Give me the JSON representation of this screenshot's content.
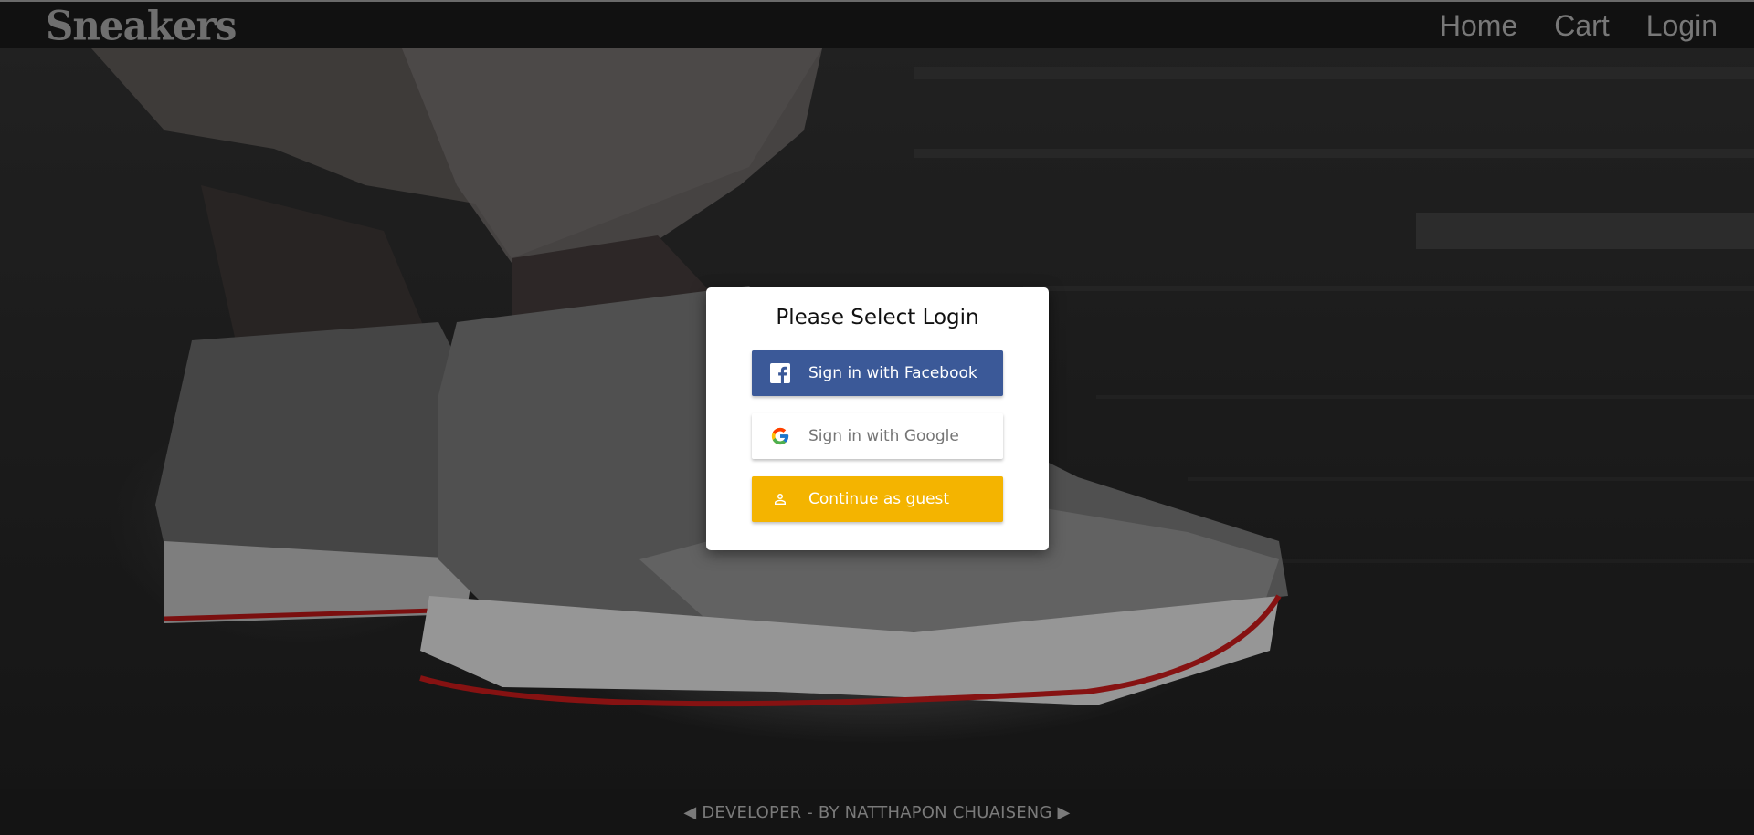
{
  "navbar": {
    "logo": "Sneakers",
    "links": [
      {
        "label": "Home"
      },
      {
        "label": "Cart"
      },
      {
        "label": "Login"
      }
    ]
  },
  "dialog": {
    "title": "Please Select Login",
    "facebook_label": "Sign in with Facebook",
    "google_label": "Sign in with Google",
    "guest_label": "Continue as guest"
  },
  "footer": {
    "text": "◀ DEVELOPER - BY NATTHAPON CHUAISENG ▶"
  },
  "colors": {
    "facebook": "#3b5998",
    "guest": "#f4b400",
    "navbar": "#111111"
  }
}
